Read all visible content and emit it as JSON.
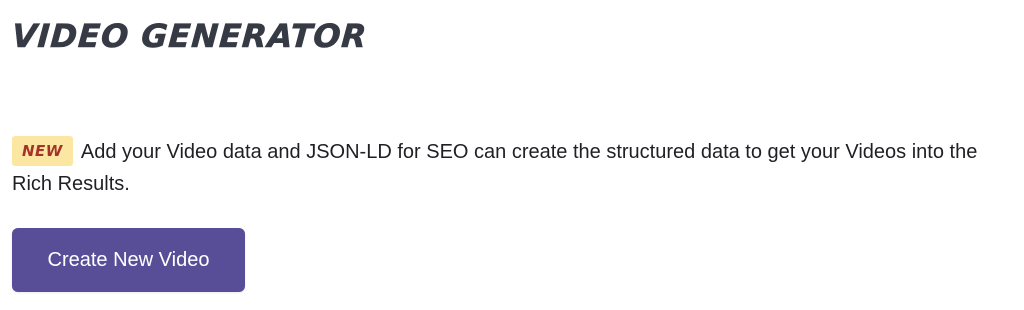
{
  "header": {
    "title": "VIDEO GENERATOR"
  },
  "intro": {
    "badge": "NEW",
    "text": "Add your Video data and JSON-LD for SEO can create the structured data to get your Videos into the Rich Results."
  },
  "actions": {
    "create_label": "Create New Video"
  },
  "colors": {
    "title": "#363a44",
    "badge_bg": "#fbe7a2",
    "badge_text": "#a4342a",
    "button_bg": "#584e98",
    "button_text": "#ffffff"
  }
}
